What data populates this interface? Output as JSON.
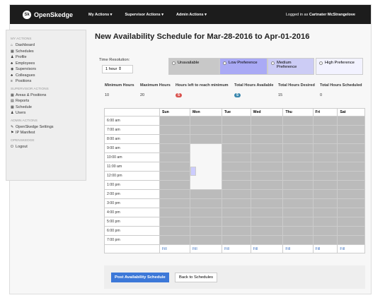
{
  "navbar": {
    "brand": "OpenSkedge",
    "logo_text": "Sk",
    "menus": [
      "My Actions ▾",
      "Supervisor Actions ▾",
      "Admin Actions ▾"
    ],
    "user_prefix": "Logged in as",
    "user_name": "Cartnater McStrangelove"
  },
  "sidebar": {
    "sections": [
      {
        "title": "My Actions",
        "items": [
          {
            "icon": "home-icon",
            "glyph": "⌂",
            "label": "Dashboard"
          },
          {
            "icon": "calendar-icon",
            "glyph": "▦",
            "label": "Schedules"
          },
          {
            "icon": "user-icon",
            "glyph": "♟",
            "label": "Profile"
          },
          {
            "icon": "employees-icon",
            "glyph": "♣",
            "label": "Employees"
          },
          {
            "icon": "eye-icon",
            "glyph": "◉",
            "label": "Supervisors"
          },
          {
            "icon": "colleagues-icon",
            "glyph": "♣",
            "label": "Colleagues"
          },
          {
            "icon": "list-icon",
            "glyph": "≡",
            "label": "Positions"
          }
        ]
      },
      {
        "title": "Supervisor Actions",
        "items": [
          {
            "icon": "grid-icon",
            "glyph": "▦",
            "label": "Areas & Positions"
          },
          {
            "icon": "reports-icon",
            "glyph": "▤",
            "label": "Reports"
          },
          {
            "icon": "schedule-icon",
            "glyph": "▦",
            "label": "Schedule"
          },
          {
            "icon": "users-icon",
            "glyph": "♟",
            "label": "Users"
          }
        ]
      },
      {
        "title": "Admin Actions",
        "items": [
          {
            "icon": "wrench-icon",
            "glyph": "✎",
            "label": "OpenSkedge Settings"
          },
          {
            "icon": "ip-icon",
            "glyph": "⚑",
            "label": "IP Manifest"
          }
        ]
      },
      {
        "title": "OpenSkedge",
        "items": [
          {
            "icon": "power-icon",
            "glyph": "⏻",
            "label": "Logout"
          }
        ]
      }
    ]
  },
  "page": {
    "title": "New Availability Schedule for Mar-28-2016 to Apr-01-2016",
    "time_resolution_label": "Time Resolution:",
    "time_resolution_value": "1 hour  ⇕"
  },
  "preferences": [
    {
      "label": "Unavailable",
      "bg": "#c8c8c8"
    },
    {
      "label": "Low Preference",
      "bg": "#aaaaf5"
    },
    {
      "label": "Medium Preference",
      "bg": "#ccccf5"
    },
    {
      "label": "High Preference",
      "bg": "#f2f2ff"
    }
  ],
  "stats": {
    "headers": [
      "Minimum Hours",
      "Maximum Hours",
      "Hours left to reach minimum",
      "Total Hours Available",
      "Total Hours Desired",
      "Total Hours Scheduled"
    ],
    "values": [
      "10",
      "20",
      "5",
      "5",
      "15",
      "0"
    ],
    "badge_colors": {
      "left": "#d9534f",
      "available": "#3a87ad"
    }
  },
  "grid": {
    "days": [
      "Sun",
      "Mon",
      "Tue",
      "Wed",
      "Thu",
      "Fri",
      "Sat"
    ],
    "times": [
      "6:00 am",
      "7:00 am",
      "8:00 am",
      "9:00 am",
      "10:00 am",
      "11:00 am",
      "12:00 pm",
      "1:00 pm",
      "2:00 pm",
      "3:00 pm",
      "4:00 pm",
      "5:00 pm",
      "6:00 pm",
      "7:00 pm"
    ],
    "fill_label": "Fill",
    "preferred_cells": [
      [
        3,
        1
      ],
      [
        4,
        1
      ],
      [
        5,
        1
      ],
      [
        6,
        1
      ],
      [
        7,
        1
      ]
    ]
  },
  "footer": {
    "post_button": "Post Availability Schedule",
    "back_button": "Back to Schedules"
  }
}
